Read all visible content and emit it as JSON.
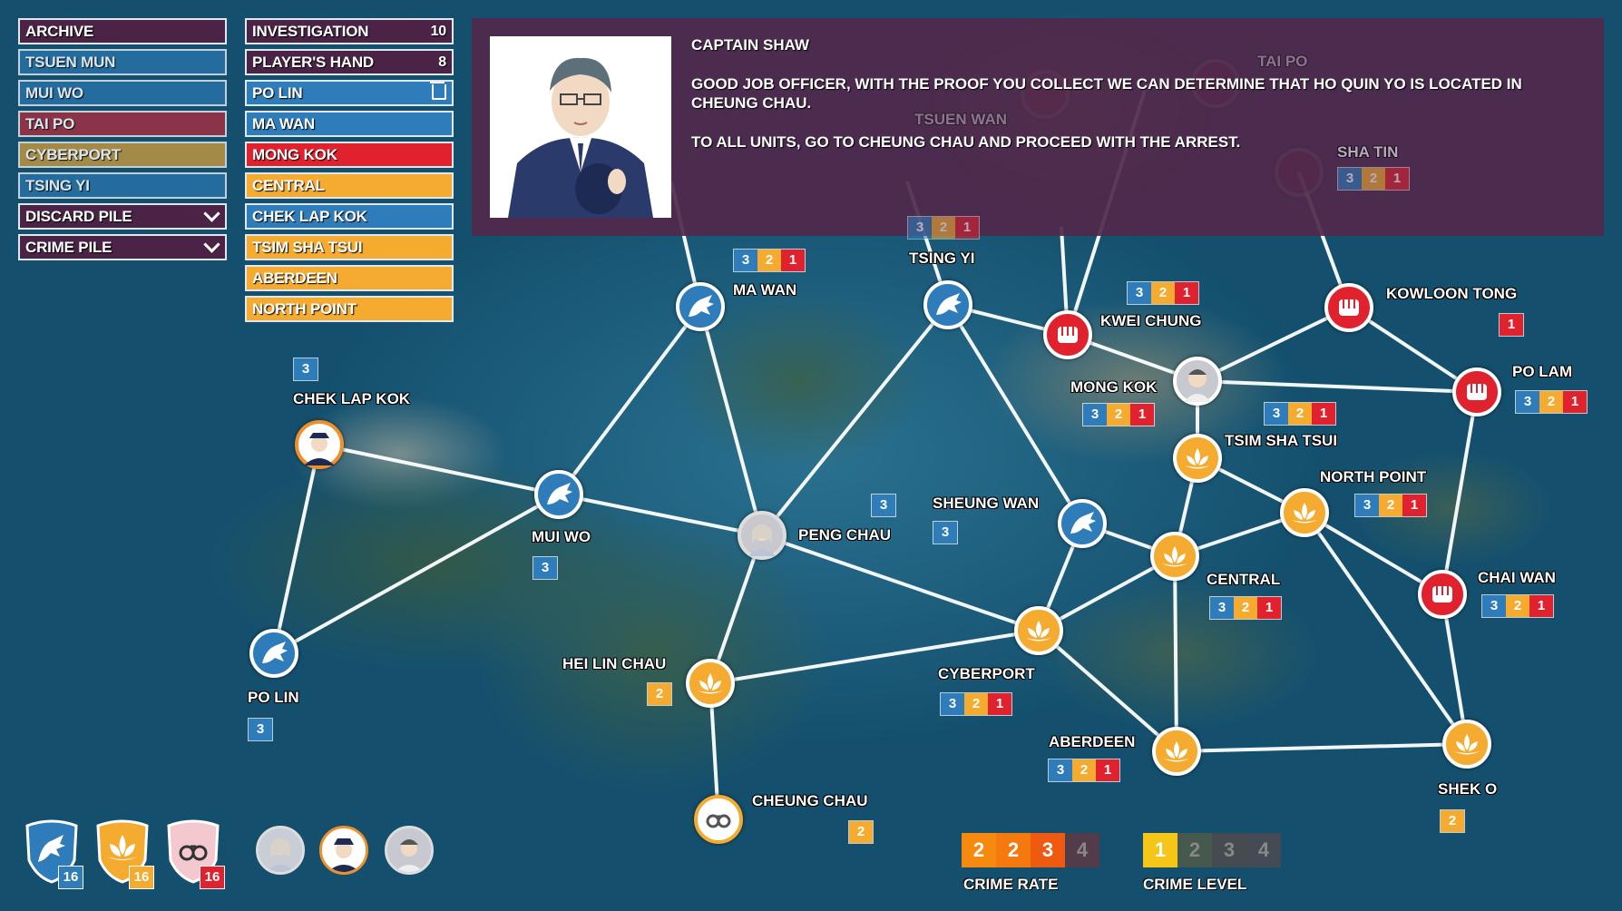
{
  "left_panel": {
    "categories": [
      {
        "label": "ARCHIVE",
        "color": "#4a2346"
      },
      {
        "label": "TSUEN MUN",
        "color": "#2e7cb9"
      },
      {
        "label": "MUI WO",
        "color": "#2e7cb9"
      },
      {
        "label": "TAI PO",
        "color": "#b8283a"
      },
      {
        "label": "CYBERPORT",
        "color": "#e8a534"
      },
      {
        "label": "TSING YI",
        "color": "#2e7cb9"
      },
      {
        "label": "DISCARD PILE",
        "color": "#4a2346"
      },
      {
        "label": "CRIME PILE",
        "color": "#4a2346"
      }
    ],
    "hand_header": {
      "label": "INVESTIGATION",
      "count": "10"
    },
    "player_hand_header": {
      "label": "PLAYER'S HAND",
      "count": "8"
    },
    "hand_cards": [
      {
        "label": "PO LIN",
        "color": "#2e7cb9"
      },
      {
        "label": "MA WAN",
        "color": "#2e7cb9"
      },
      {
        "label": "MONG KOK",
        "color": "#e0222f"
      },
      {
        "label": "CENTRAL",
        "color": "#f5ab30"
      },
      {
        "label": "CHEK LAP KOK",
        "color": "#2e7cb9"
      },
      {
        "label": "TSIM SHA TSUI",
        "color": "#f5ab30"
      },
      {
        "label": "ABERDEEN",
        "color": "#f5ab30"
      },
      {
        "label": "NORTH POINT",
        "color": "#f5ab30"
      }
    ]
  },
  "dialog": {
    "speaker": "CAPTAIN SHAW",
    "line1": "GOOD JOB OFFICER, WITH THE PROOF YOU COLLECT WE CAN DETERMINE THAT HO QUIN YO IS LOCATED IN CHEUNG CHAU.",
    "line2": "TO ALL UNITS, GO TO CHEUNG CHAU AND PROCEED WITH THE ARREST."
  },
  "locations": {
    "ma_wan": {
      "name": "MA WAN"
    },
    "tsing_yi": {
      "name": "TSING YI"
    },
    "kwei_chung": {
      "name": "KWEI CHUNG"
    },
    "kowloon_tong": {
      "name": "KOWLOON TONG"
    },
    "chek_lap_kok": {
      "name": "CHEK LAP KOK"
    },
    "mong_kok": {
      "name": "MONG KOK"
    },
    "po_lam": {
      "name": "PO LAM"
    },
    "tsim_sha_tsui": {
      "name": "TSIM SHA TSUI"
    },
    "mui_wo": {
      "name": "MUI WO"
    },
    "peng_chau": {
      "name": "PENG CHAU"
    },
    "sheung_wan": {
      "name": "SHEUNG WAN"
    },
    "north_point": {
      "name": "NORTH POINT"
    },
    "central": {
      "name": "CENTRAL"
    },
    "chai_wan": {
      "name": "CHAI WAN"
    },
    "hei_lin_chau": {
      "name": "HEI LIN CHAU"
    },
    "cyberport": {
      "name": "CYBERPORT"
    },
    "po_lin": {
      "name": "PO LIN"
    },
    "aberdeen": {
      "name": "ABERDEEN"
    },
    "shek_o": {
      "name": "SHEK O"
    },
    "cheung_chau": {
      "name": "CHEUNG CHAU"
    },
    "tsuen_wan": {
      "name": "TSUEN WAN"
    },
    "tai_po": {
      "name": "TAI PO"
    },
    "sha_tin": {
      "name": "SHA TIN"
    }
  },
  "counter_values": {
    "blue": "3",
    "orange": "2",
    "red": "1"
  },
  "single_counters": {
    "chek_lap_kok": "3",
    "mui_wo": "3",
    "peng_chau": "3",
    "sheung_wan": "3",
    "po_lin": "3",
    "kowloon_tong": "1",
    "hei_lin_chau": "2",
    "cheung_chau": "2",
    "shek_o": "2"
  },
  "badges": {
    "dragon": "16",
    "lotus": "16",
    "cuffs": "16"
  },
  "crime_rate": {
    "label": "CRIME RATE",
    "values": [
      "2",
      "2",
      "3",
      "4"
    ],
    "colors": [
      "#f58a0e",
      "#f57a0e",
      "#ee5a10",
      "#5a3a45"
    ]
  },
  "crime_level": {
    "label": "CRIME LEVEL",
    "values": [
      "1",
      "2",
      "3",
      "4"
    ],
    "colors": [
      "#f5c518",
      "#4a5a4a",
      "#4a4a4a",
      "#4a4a52"
    ]
  }
}
